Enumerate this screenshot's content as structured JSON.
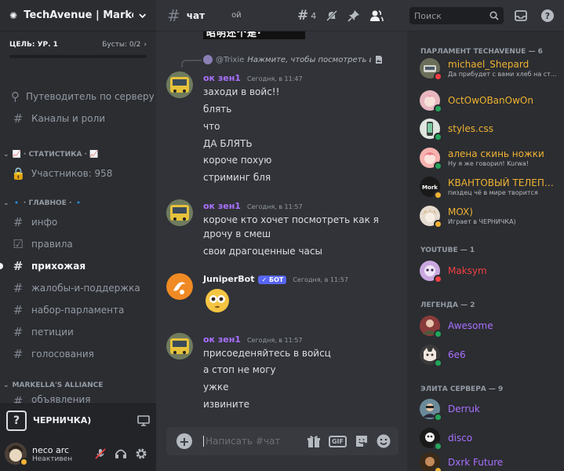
{
  "colors": {
    "parliament": "#f0b232",
    "youtube": "#f23f43",
    "legend": "#a970ff",
    "elite": "#a970ff",
    "author_green": "#a970ff",
    "bot_blue": "#5865f2",
    "accent": "#f2f3f5"
  },
  "server": {
    "name": "TechAvenue | Markelle's",
    "goal_level": "ЦЕЛЬ: УР. 1",
    "boosts": "Бусты: 0/2"
  },
  "sidebar": {
    "items": [
      {
        "label": "Путеводитель по серверу",
        "icon": "compass-icon"
      },
      {
        "label": "Каналы и роли",
        "icon": "channels-roles-icon"
      }
    ],
    "cat_stats": "📈 · СТАТИСТИКА · 📈",
    "stat_members": "Участников: 958",
    "cat_main": "🔹 · ГЛАВНОЕ · 🔹",
    "channels": [
      {
        "label": "инфо"
      },
      {
        "label": "правила"
      },
      {
        "label": "прихожая"
      },
      {
        "label": "жалобы-и-поддержка"
      },
      {
        "label": "набор-парламента"
      },
      {
        "label": "петиции"
      },
      {
        "label": "голосования"
      }
    ],
    "cat_alliance": "MARKELLA'S ALLIANCE",
    "alliance_partial": "объявления"
  },
  "voice": {
    "name": "ЧЕРНИЧКА)"
  },
  "user": {
    "name": "neco arc",
    "status": "Неактивен"
  },
  "topbar": {
    "channel": "чат",
    "topic": "ой",
    "threads_count": "4",
    "search_placeholder": "Поиск"
  },
  "messages": {
    "image_text": "昭明还个是·",
    "reply": {
      "name": "@Trixie",
      "text": "Нажмите, чтобы посмотреть вложение"
    },
    "groups": [
      {
        "author": "ок зен1",
        "time": "Сегодня, в 11:47",
        "lines": [
          "заходи в войс!!",
          "блять",
          "что",
          "ДА БЛЯТЬ",
          "короче похую",
          "стриминг бля"
        ]
      },
      {
        "author": "ок зен1",
        "time": "Сегодня, в 11:57",
        "lines": [
          "короче кто хочет посмотреть как я",
          "дрочу в смеш",
          "свои драгоценные часы"
        ]
      },
      {
        "author": "JuniperBot",
        "bot": "БОТ",
        "time": "Сегодня, в 11:57",
        "lines": []
      },
      {
        "author": "ок зен1",
        "time": "Сегодня, в 11:57",
        "lines": [
          "присоеденяйтесь в войсц",
          "а стоп не могу",
          "ужке",
          "извините"
        ]
      }
    ]
  },
  "composer": {
    "placeholder": "Написать #чат",
    "gif": "GIF"
  },
  "members": {
    "head_parliament": "ПАРЛАМЕНТ TECHAVENUE — 6",
    "head_youtube": "YOUTUBE — 1",
    "head_legend": "ЛЕГЕНДА — 2",
    "head_elite": "ЭЛИТА СЕРВЕРА — 9",
    "list": [
      {
        "name": "michael_Shepard",
        "sub": "Да прибудет с вами хлеб на столе",
        "status": "dnd",
        "group": "parliament"
      },
      {
        "name": "OctOwOBanOwOn",
        "sub": "",
        "status": "online",
        "group": "parliament"
      },
      {
        "name": "styles.css",
        "sub": "",
        "status": "online",
        "group": "parliament"
      },
      {
        "name": "алена скинь ножки",
        "sub": "Ну я же говорил! Kurwa!",
        "status": "online",
        "group": "parliament"
      },
      {
        "name": "КВАНТОВЫЙ ТЕЛЕПОРТ",
        "sub": "пиздец чё в мире творится",
        "status": "idle",
        "group": "parliament"
      },
      {
        "name": "MOX)",
        "sub": "Играет в ЧЕРНИЧКА)",
        "status": "idle",
        "group": "parliament"
      },
      {
        "name": "Maksym",
        "sub": "",
        "status": "dnd",
        "group": "youtube"
      },
      {
        "name": "Awesome",
        "sub": "",
        "status": "online",
        "group": "legend"
      },
      {
        "name": "6e6",
        "sub": "",
        "status": "online",
        "group": "legend"
      },
      {
        "name": "Derruk",
        "sub": "",
        "status": "online",
        "group": "elite"
      },
      {
        "name": "disco",
        "sub": "",
        "status": "online",
        "group": "elite"
      },
      {
        "name": "Dxrk Future",
        "sub": "",
        "status": "idle",
        "group": "elite"
      }
    ]
  }
}
